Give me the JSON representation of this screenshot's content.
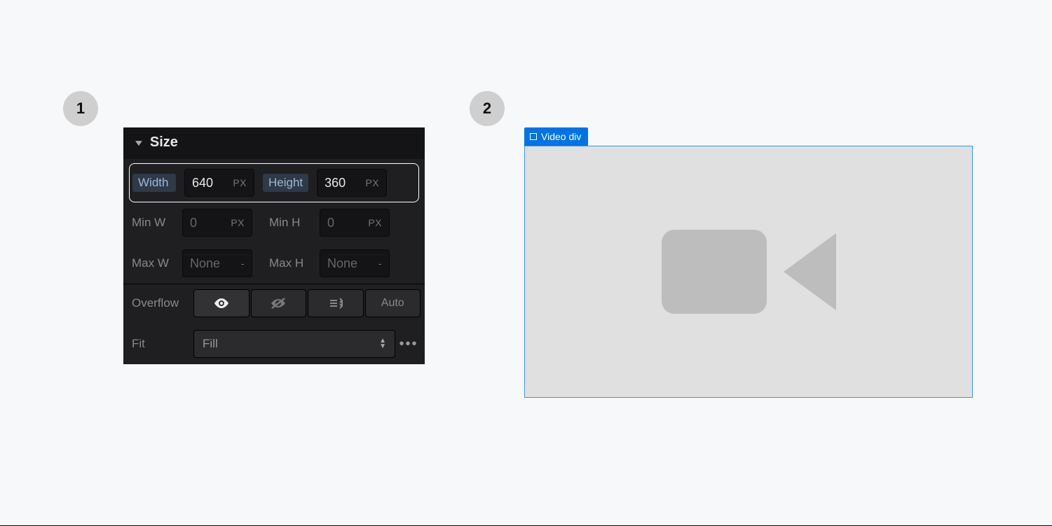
{
  "steps": {
    "one": "1",
    "two": "2"
  },
  "panel": {
    "title": "Size",
    "width": {
      "label": "Width",
      "value": "640",
      "unit": "PX"
    },
    "height": {
      "label": "Height",
      "value": "360",
      "unit": "PX"
    },
    "minw": {
      "label": "Min W",
      "value": "0",
      "unit": "PX"
    },
    "minh": {
      "label": "Min H",
      "value": "0",
      "unit": "PX"
    },
    "maxw": {
      "label": "Max W",
      "value": "None",
      "unit": "-"
    },
    "maxh": {
      "label": "Max H",
      "value": "None",
      "unit": "-"
    },
    "overflow": {
      "label": "Overflow",
      "auto": "Auto"
    },
    "fit": {
      "label": "Fit",
      "value": "Fill"
    }
  },
  "video": {
    "tag": "Video div"
  }
}
